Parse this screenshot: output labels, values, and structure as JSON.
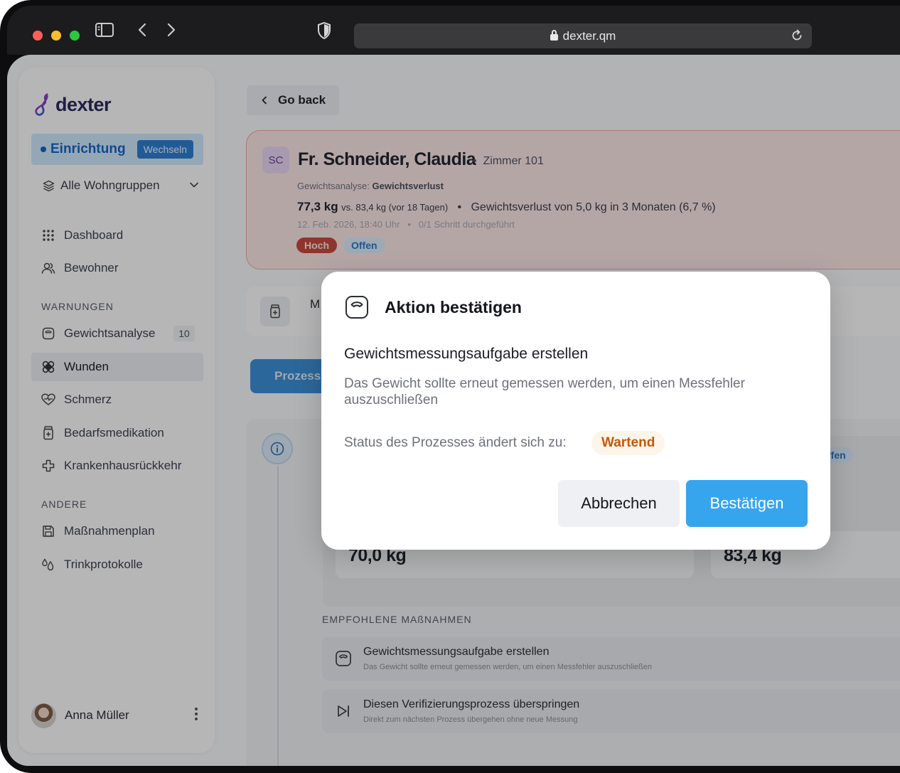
{
  "browser": {
    "url": "dexter.qm"
  },
  "sidebar": {
    "logo_text": "dexter",
    "facility": {
      "label": "Einrichtung",
      "switch_label": "Wechseln"
    },
    "group_selector": "Alle Wohngruppen",
    "main_items": [
      {
        "label": "Dashboard",
        "icon": "grid-icon"
      },
      {
        "label": "Bewohner",
        "icon": "users-icon"
      }
    ],
    "warnings_label": "WARNUNGEN",
    "warning_items": [
      {
        "label": "Gewichtsanalyse",
        "icon": "scale-icon",
        "count": "10"
      },
      {
        "label": "Wunden",
        "icon": "bandage-icon"
      },
      {
        "label": "Schmerz",
        "icon": "heart-pulse-icon"
      },
      {
        "label": "Bedarfsmedikation",
        "icon": "pill-bottle-icon"
      },
      {
        "label": "Krankenhausrückkehr",
        "icon": "hospital-cross-icon"
      }
    ],
    "other_label": "ANDERE",
    "other_items": [
      {
        "label": "Maßnahmenplan",
        "icon": "save-icon"
      },
      {
        "label": "Trinkprotokolle",
        "icon": "drops-icon"
      }
    ],
    "user_name": "Anna Müller"
  },
  "main": {
    "go_back": "Go back",
    "alert": {
      "initials": "SC",
      "name": "Fr. Schneider, Claudia",
      "room": "Zimmer 101",
      "analysis_prefix": "Gewichtsanalyse:",
      "analysis_type": "Gewichtsverlust",
      "current_weight": "77,3 kg",
      "comparison": "vs. 83,4 kg (vor 18 Tagen)",
      "summary": "Gewichtsverlust von 5,0 kg in 3 Monaten (6,7 %)",
      "date": "12. Feb. 2026, 18:40 Uhr",
      "steps": "0/1 Schritt durchgeführt",
      "priority": "Hoch",
      "state": "Offen"
    },
    "med_text": "M",
    "process_tab": "Prozess",
    "timeline": {
      "state": "ffen",
      "weight_a": "70,0 kg",
      "weight_b": "83,4 kg",
      "recommended_label": "EMPFOHLENE MAßNAHMEN",
      "actions": [
        {
          "title": "Gewichtsmessungsaufgabe erstellen",
          "desc": "Das Gewicht sollte erneut gemessen werden, um einen Messfehler auszuschließen"
        },
        {
          "title": "Diesen Verifizierungsprozess überspringen",
          "desc": "Direkt zum nächsten Prozess übergehen ohne neue Messung"
        }
      ]
    }
  },
  "modal": {
    "title": "Aktion bestätigen",
    "subtitle": "Gewichtsmessungsaufgabe erstellen",
    "description": "Das Gewicht sollte erneut gemessen werden, um einen Messfehler auszuschließen",
    "status_label": "Status des Prozesses ändert sich zu:",
    "status_value": "Wartend",
    "cancel_label": "Abbrechen",
    "confirm_label": "Bestätigen"
  },
  "colors": {
    "accent": "#36a5ee",
    "status_waiting": "#c4580b",
    "priority_high": "#c64a3f"
  }
}
